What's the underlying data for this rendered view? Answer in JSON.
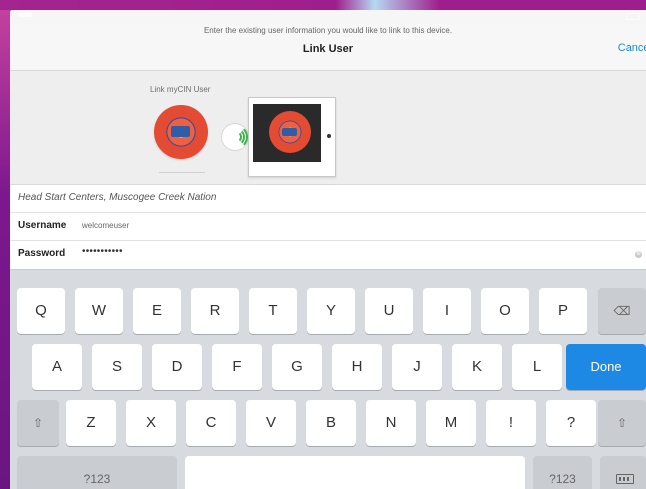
{
  "prompt": "Enter the existing user information you would like to link to this device.",
  "nav": {
    "title": "Link User",
    "cancel_label": "Cancel"
  },
  "illustration": {
    "caption": "Link myCIN User"
  },
  "form": {
    "organization": "Head Start Centers, Muscogee Creek Nation",
    "username_label": "Username",
    "username_value": "welcomeuser",
    "password_label": "Password",
    "password_mask": "•••••••••••",
    "clear_icon": "⊗"
  },
  "keyboard": {
    "row1": [
      "Q",
      "W",
      "E",
      "R",
      "T",
      "Y",
      "U",
      "I",
      "O",
      "P"
    ],
    "row2": [
      "A",
      "S",
      "D",
      "F",
      "G",
      "H",
      "J",
      "K",
      "L"
    ],
    "row3": [
      "Z",
      "X",
      "C",
      "V",
      "B",
      "N",
      "M",
      "!",
      "?"
    ],
    "shift_icon": "⇧",
    "backspace_icon": "⌫",
    "done_label": "Done",
    "number_label_left": "?123",
    "number_label_right": "?123",
    "space_label": "",
    "keyboard_icon": "keyboard-icon"
  }
}
